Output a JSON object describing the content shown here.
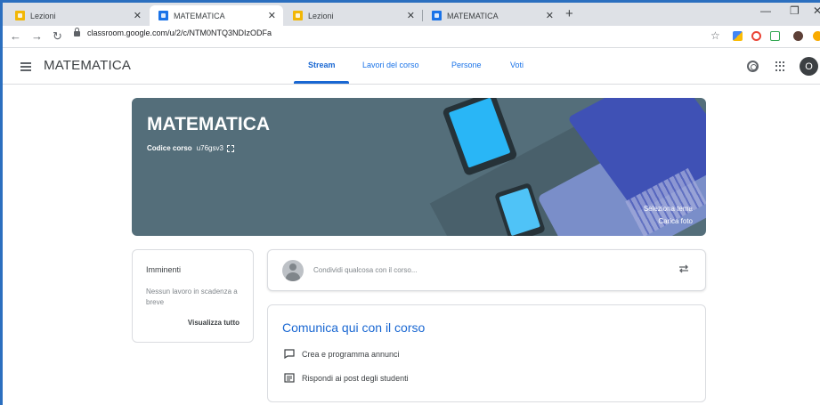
{
  "browser": {
    "tabs": [
      {
        "label": "Lezioni",
        "favicon": "classroom-yellow"
      },
      {
        "label": "MATEMATICA",
        "favicon": "classroom-blue"
      },
      {
        "label": "Lezioni",
        "favicon": "classroom-yellow"
      },
      {
        "label": "MATEMATICA",
        "favicon": "classroom-blue"
      }
    ],
    "new_tab": "+",
    "url": "classroom.google.com/u/2/c/NTM0NTQ3NDIzODFa"
  },
  "header": {
    "title": "MATEMATICA",
    "tabs": [
      {
        "label": "Stream"
      },
      {
        "label": "Lavori del corso"
      },
      {
        "label": "Persone"
      },
      {
        "label": "Voti"
      }
    ],
    "avatar_letter": "O",
    "accent": "#1967d2"
  },
  "banner": {
    "title": "MATEMATICA",
    "code_label": "Codice corso",
    "code_value": "u76gsv3",
    "select_theme": "Seleziona tema",
    "upload_photo": "Carica foto",
    "color": "#546e7a"
  },
  "upcoming": {
    "title": "Imminenti",
    "empty_text": "Nessun lavoro in scadenza a breve",
    "view_all": "Visualizza tutto"
  },
  "share": {
    "placeholder": "Condividi qualcosa con il corso..."
  },
  "announce": {
    "title": "Comunica qui con il corso",
    "items": [
      {
        "label": "Crea e programma annunci",
        "icon": "announcement-icon"
      },
      {
        "label": "Rispondi ai post degli studenti",
        "icon": "comment-icon"
      }
    ]
  }
}
